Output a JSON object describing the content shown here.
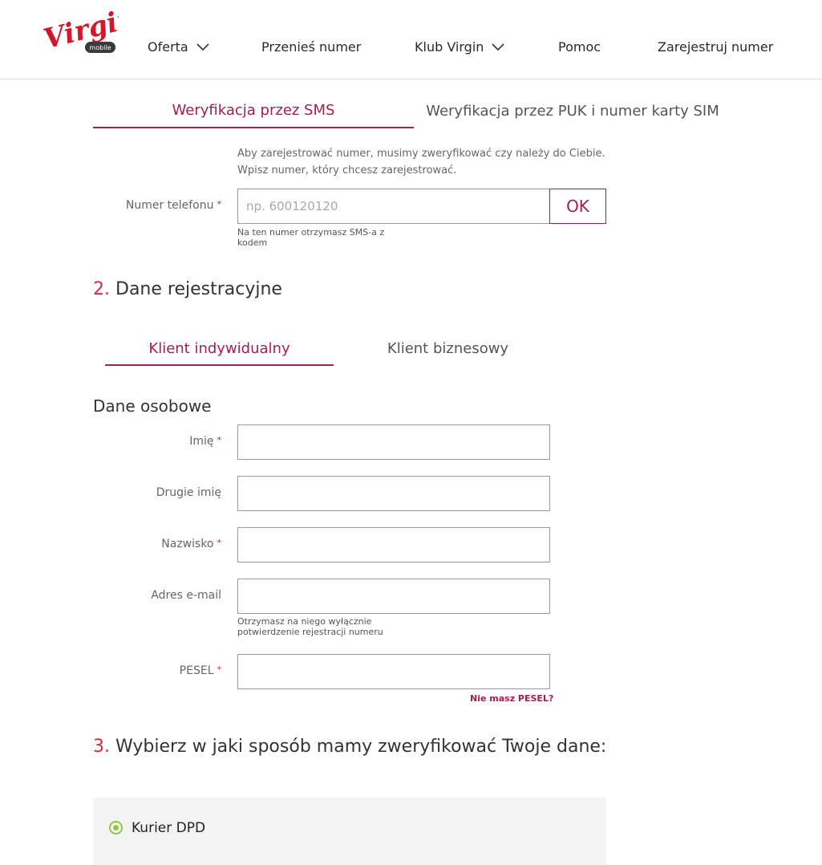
{
  "header": {
    "logo_text": "Virgin",
    "logo_sub": "mobile",
    "nav": [
      {
        "label": "Oferta",
        "has_dropdown": true
      },
      {
        "label": "Przenieś numer",
        "has_dropdown": false
      },
      {
        "label": "Klub Virgin",
        "has_dropdown": true
      },
      {
        "label": "Pomoc",
        "has_dropdown": false
      },
      {
        "label": "Zarejestruj numer",
        "has_dropdown": false
      }
    ]
  },
  "verification": {
    "tabs": [
      {
        "label": "Weryfikacja przez SMS",
        "active": true
      },
      {
        "label": "Weryfikacja przez PUK i numer karty SIM",
        "active": false
      }
    ],
    "hint_line1": "Aby zarejestrować numer, musimy zweryfikować czy należy do Ciebie.",
    "hint_line2": "Wpisz numer, który chcesz zarejestrować.",
    "phone_label": "Numer telefonu",
    "required_mark": "*",
    "phone_placeholder": "np. 600120120",
    "phone_value": "",
    "ok_label": "OK",
    "phone_note_line1": "Na ten numer otrzymasz SMS-a z",
    "phone_note_line2": "kodem"
  },
  "registration": {
    "number": "2.",
    "title": "Dane rejestracyjne",
    "client_tabs": [
      {
        "label": "Klient indywidualny",
        "active": true
      },
      {
        "label": "Klient biznesowy",
        "active": false
      }
    ],
    "personal_heading": "Dane osobowe",
    "fields": {
      "first_name": {
        "label": "Imię",
        "required": true,
        "value": ""
      },
      "middle_name": {
        "label": "Drugie imię",
        "required": false,
        "value": ""
      },
      "last_name": {
        "label": "Nazwisko",
        "required": true,
        "value": ""
      },
      "email": {
        "label": "Adres e-mail",
        "required": false,
        "value": "",
        "note_line1": "Otrzymasz na niego wyłącznie",
        "note_line2": "potwierdzenie rejestracji numeru"
      },
      "pesel": {
        "label": "PESEL",
        "required": true,
        "value": "",
        "link": "Nie masz PESEL?"
      }
    }
  },
  "verify_method": {
    "number": "3.",
    "title": "Wybierz w jaki sposób mamy zweryfikować Twoje dane:",
    "options": [
      {
        "label": "Kurier DPD",
        "selected": true
      }
    ]
  },
  "colors": {
    "accent": "#a41e4f",
    "section_number": "#d42a3c",
    "radio": "#8dc63f",
    "logo": "#d3172b"
  }
}
